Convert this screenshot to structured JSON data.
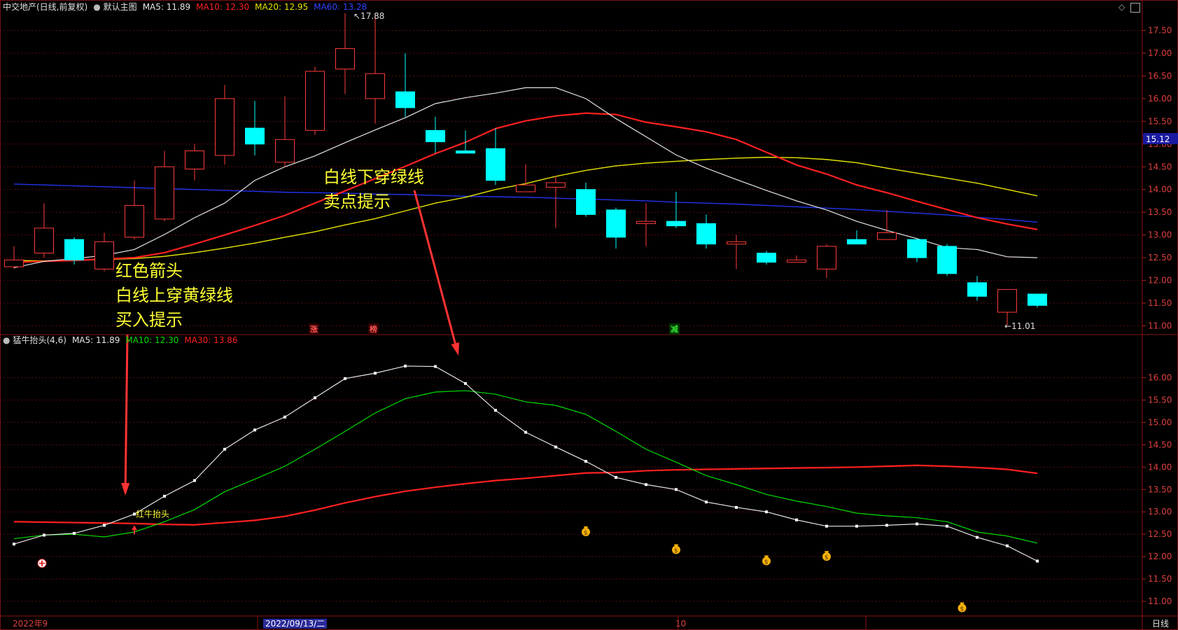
{
  "main": {
    "stock_name": "中交地产(日线,前复权)",
    "template": "默认主图",
    "ma5_label": "MA5: 11.89",
    "ma10_label": "MA10: 12.30",
    "ma20_label": "MA20: 12.95",
    "ma60_label": "MA60: 13.28",
    "current_price_label": "15.12",
    "high_marker": "17.88",
    "low_marker": "11.01",
    "badges": [
      "涨",
      "榜",
      "减"
    ]
  },
  "sub": {
    "indicator_name": "猛牛抬头(4,6)",
    "ma5_label": "MA5: 11.89",
    "ma10_label": "MA10: 12.30",
    "ma30_label": "MA30: 13.86",
    "signal_label": "红牛抬头"
  },
  "annotations": {
    "buy_lines": [
      "红色箭头",
      "白线上穿黄绿线",
      "买入提示"
    ],
    "sell_lines": [
      "白线下穿绿线",
      "卖点提示"
    ]
  },
  "axis": {
    "date_labels": [
      "2022年9",
      "2022/09/13/二",
      "10"
    ],
    "period_label": "日线"
  },
  "colors": {
    "bull": "#ff3b3b",
    "bear": "#00ffff",
    "ma5": "#e6e6e6",
    "ma10": "#ff2020",
    "ma20": "#e6e600",
    "ma60": "#2233ee",
    "sub_ma10": "#00dd00",
    "annotation": "#ffff33",
    "arrow": "#ff3333"
  },
  "chart_data": [
    {
      "type": "candlestick",
      "ylim": [
        10.9,
        17.8
      ],
      "yticks": [
        11.0,
        11.5,
        12.0,
        12.5,
        13.0,
        13.5,
        14.0,
        14.5,
        15.0,
        15.5,
        16.0,
        16.5,
        17.0,
        17.5
      ],
      "candles": [
        {
          "o": 12.3,
          "c": 12.45,
          "h": 12.75,
          "l": 12.25
        },
        {
          "o": 12.6,
          "c": 13.15,
          "h": 13.7,
          "l": 12.5
        },
        {
          "o": 12.9,
          "c": 12.45,
          "h": 12.95,
          "l": 12.35
        },
        {
          "o": 12.25,
          "c": 12.85,
          "h": 13.05,
          "l": 12.2
        },
        {
          "o": 12.95,
          "c": 13.65,
          "h": 14.2,
          "l": 12.9
        },
        {
          "o": 13.35,
          "c": 14.5,
          "h": 14.85,
          "l": 13.3
        },
        {
          "o": 14.45,
          "c": 14.85,
          "h": 15.0,
          "l": 14.2
        },
        {
          "o": 14.75,
          "c": 16.0,
          "h": 16.3,
          "l": 14.55
        },
        {
          "o": 15.35,
          "c": 15.0,
          "h": 15.95,
          "l": 14.75
        },
        {
          "o": 14.6,
          "c": 15.1,
          "h": 16.05,
          "l": 14.5
        },
        {
          "o": 15.3,
          "c": 16.6,
          "h": 16.7,
          "l": 15.2
        },
        {
          "o": 16.65,
          "c": 17.1,
          "h": 17.88,
          "l": 16.1
        },
        {
          "o": 16.0,
          "c": 16.55,
          "h": 17.85,
          "l": 15.45
        },
        {
          "o": 16.15,
          "c": 15.8,
          "h": 17.0,
          "l": 15.6
        },
        {
          "o": 15.3,
          "c": 15.05,
          "h": 15.6,
          "l": 14.8
        },
        {
          "o": 14.85,
          "c": 14.8,
          "h": 15.3,
          "l": 14.8
        },
        {
          "o": 14.9,
          "c": 14.2,
          "h": 15.35,
          "l": 14.1
        },
        {
          "o": 13.95,
          "c": 14.1,
          "h": 14.55,
          "l": 13.95
        },
        {
          "o": 14.05,
          "c": 14.15,
          "h": 14.3,
          "l": 13.15
        },
        {
          "o": 14.0,
          "c": 13.45,
          "h": 14.15,
          "l": 13.4
        },
        {
          "o": 13.55,
          "c": 12.95,
          "h": 13.6,
          "l": 12.7
        },
        {
          "o": 13.25,
          "c": 13.3,
          "h": 13.7,
          "l": 12.75
        },
        {
          "o": 13.3,
          "c": 13.2,
          "h": 13.95,
          "l": 13.15
        },
        {
          "o": 13.25,
          "c": 12.8,
          "h": 13.45,
          "l": 12.7
        },
        {
          "o": 12.8,
          "c": 12.85,
          "h": 13.0,
          "l": 12.25
        },
        {
          "o": 12.6,
          "c": 12.4,
          "h": 12.65,
          "l": 12.35
        },
        {
          "o": 12.4,
          "c": 12.45,
          "h": 12.55,
          "l": 12.4
        },
        {
          "o": 12.25,
          "c": 12.75,
          "h": 12.8,
          "l": 12.05
        },
        {
          "o": 12.9,
          "c": 12.8,
          "h": 13.1,
          "l": 12.8
        },
        {
          "o": 12.9,
          "c": 13.05,
          "h": 13.55,
          "l": 12.9
        },
        {
          "o": 12.9,
          "c": 12.5,
          "h": 12.9,
          "l": 12.4
        },
        {
          "o": 12.75,
          "c": 12.15,
          "h": 12.8,
          "l": 12.1
        },
        {
          "o": 11.95,
          "c": 11.65,
          "h": 12.1,
          "l": 11.55
        },
        {
          "o": 11.3,
          "c": 11.8,
          "h": 11.8,
          "l": 11.01
        },
        {
          "o": 11.7,
          "c": 11.45,
          "h": 11.7,
          "l": 11.4
        }
      ],
      "series": [
        {
          "name": "MA5",
          "values": [
            12.28,
            12.42,
            12.48,
            12.55,
            12.68,
            13.01,
            13.38,
            13.7,
            14.2,
            14.5,
            14.74,
            15.03,
            15.31,
            15.58,
            15.89,
            16.02,
            16.12,
            16.24,
            16.24,
            16.0,
            15.56,
            15.16,
            14.76,
            14.47,
            14.22,
            13.98,
            13.75,
            13.55,
            13.3,
            13.1,
            12.92,
            12.72,
            12.68,
            12.52,
            12.5
          ]
        },
        {
          "name": "MA10",
          "values": [
            12.4,
            12.42,
            12.44,
            12.47,
            12.5,
            12.61,
            12.8,
            13.0,
            13.21,
            13.43,
            13.7,
            13.97,
            14.24,
            14.51,
            14.79,
            15.04,
            15.34,
            15.51,
            15.62,
            15.68,
            15.65,
            15.48,
            15.38,
            15.27,
            15.1,
            14.82,
            14.54,
            14.34,
            14.1,
            13.93,
            13.74,
            13.56,
            13.38,
            13.24,
            13.12
          ]
        },
        {
          "name": "MA20",
          "values": [
            12.44,
            12.43,
            12.44,
            12.46,
            12.48,
            12.53,
            12.61,
            12.71,
            12.82,
            12.95,
            13.07,
            13.22,
            13.36,
            13.53,
            13.7,
            13.83,
            14.0,
            14.13,
            14.29,
            14.42,
            14.52,
            14.58,
            14.62,
            14.66,
            14.69,
            14.71,
            14.7,
            14.66,
            14.59,
            14.47,
            14.36,
            14.25,
            14.14,
            14.0,
            13.86
          ]
        },
        {
          "name": "MA60",
          "values": [
            14.12,
            14.1,
            14.08,
            14.06,
            14.04,
            14.02,
            14.0,
            13.98,
            13.96,
            13.94,
            13.93,
            13.92,
            13.9,
            13.89,
            13.87,
            13.85,
            13.84,
            13.83,
            13.81,
            13.79,
            13.77,
            13.75,
            13.72,
            13.7,
            13.68,
            13.65,
            13.62,
            13.59,
            13.56,
            13.52,
            13.48,
            13.44,
            13.39,
            13.34,
            13.28
          ]
        }
      ]
    },
    {
      "type": "line",
      "title": "猛牛抬头(4,6)",
      "ylim": [
        10.75,
        16.65
      ],
      "yticks": [
        11.0,
        11.5,
        12.0,
        12.5,
        13.0,
        13.5,
        14.0,
        14.5,
        15.0,
        15.5,
        16.0
      ],
      "series": [
        {
          "name": "MA5",
          "values": [
            12.28,
            12.48,
            12.52,
            12.7,
            12.95,
            13.35,
            13.7,
            14.4,
            14.83,
            15.12,
            15.55,
            15.98,
            16.1,
            16.26,
            16.25,
            15.87,
            15.27,
            14.78,
            14.45,
            14.13,
            13.77,
            13.61,
            13.5,
            13.22,
            13.1,
            13.0,
            12.82,
            12.68,
            12.68,
            12.7,
            12.73,
            12.68,
            12.43,
            12.24,
            11.9
          ]
        },
        {
          "name": "MA10",
          "values": [
            12.4,
            12.48,
            12.5,
            12.44,
            12.55,
            12.78,
            13.05,
            13.45,
            13.73,
            14.02,
            14.4,
            14.8,
            15.21,
            15.53,
            15.68,
            15.71,
            15.63,
            15.46,
            15.38,
            15.18,
            14.8,
            14.4,
            14.11,
            13.81,
            13.61,
            13.39,
            13.24,
            13.12,
            12.97,
            12.91,
            12.87,
            12.78,
            12.55,
            12.46,
            12.3
          ]
        },
        {
          "name": "MA30",
          "values": [
            12.78,
            12.77,
            12.76,
            12.75,
            12.74,
            12.72,
            12.71,
            12.76,
            12.81,
            12.9,
            13.04,
            13.2,
            13.34,
            13.46,
            13.55,
            13.63,
            13.7,
            13.75,
            13.81,
            13.87,
            13.88,
            13.92,
            13.94,
            13.95,
            13.96,
            13.97,
            13.98,
            13.99,
            14.0,
            14.02,
            14.04,
            14.02,
            13.99,
            13.95,
            13.86
          ]
        }
      ]
    }
  ]
}
